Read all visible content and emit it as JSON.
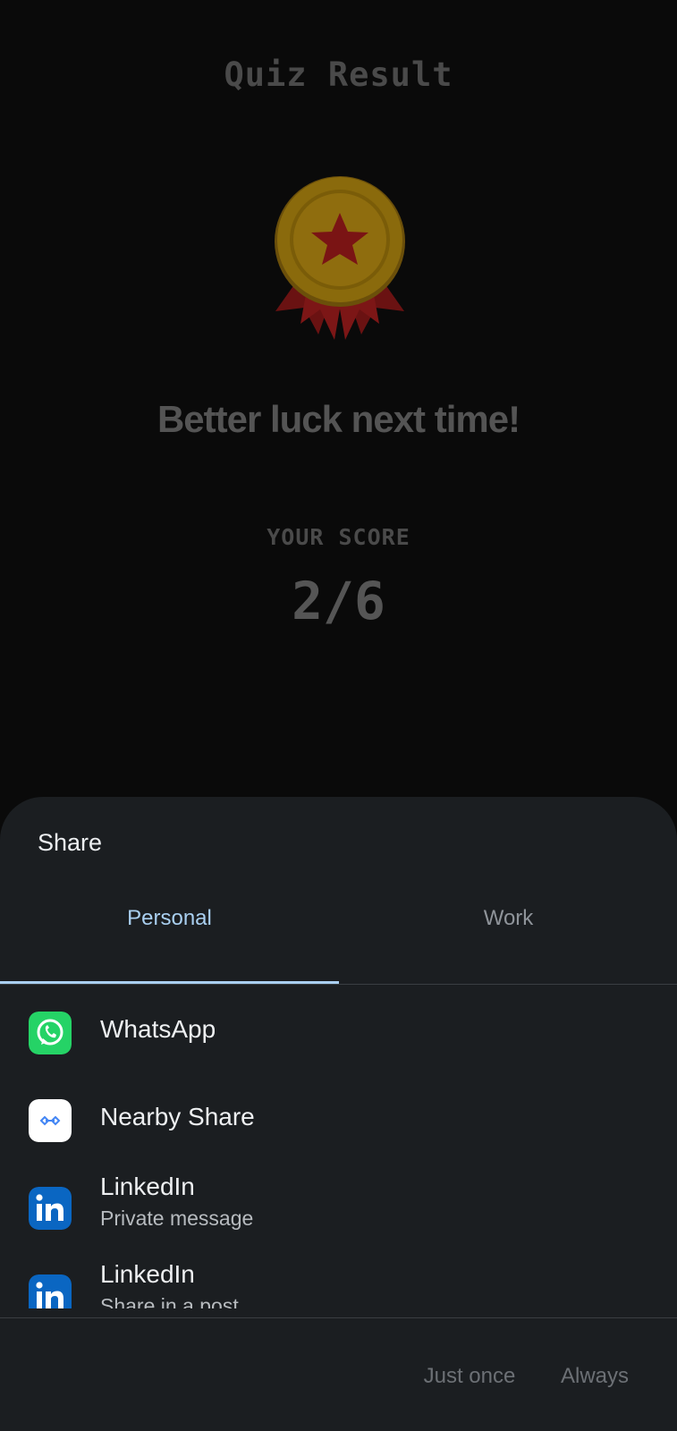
{
  "quiz": {
    "title": "Quiz Result",
    "medal_icon": "medal-star-icon",
    "message": "Better luck next time!",
    "score_label": "YOUR SCORE",
    "score_value": "2/6"
  },
  "share_sheet": {
    "title": "Share",
    "tabs": [
      {
        "label": "Personal",
        "selected": true
      },
      {
        "label": "Work",
        "selected": false
      }
    ],
    "apps": [
      {
        "name": "WhatsApp",
        "subtitle": "",
        "icon": "whatsapp-icon",
        "color": "#25d366"
      },
      {
        "name": "Nearby Share",
        "subtitle": "",
        "icon": "nearby-share-icon",
        "color": "#ffffff"
      },
      {
        "name": "LinkedIn",
        "subtitle": "Private message",
        "icon": "linkedin-icon",
        "color": "#0a66c2"
      },
      {
        "name": "LinkedIn",
        "subtitle": "Share in a post",
        "icon": "linkedin-icon",
        "color": "#0a66c2"
      }
    ],
    "buttons": {
      "just_once": "Just once",
      "always": "Always"
    }
  },
  "colors": {
    "accent": "#a9cff0",
    "sheet_background": "#1b1e21",
    "whatsapp": "#25d366",
    "linkedin": "#0a66c2",
    "medal_gold": "#e0a400",
    "medal_ribbon": "#a01818"
  }
}
